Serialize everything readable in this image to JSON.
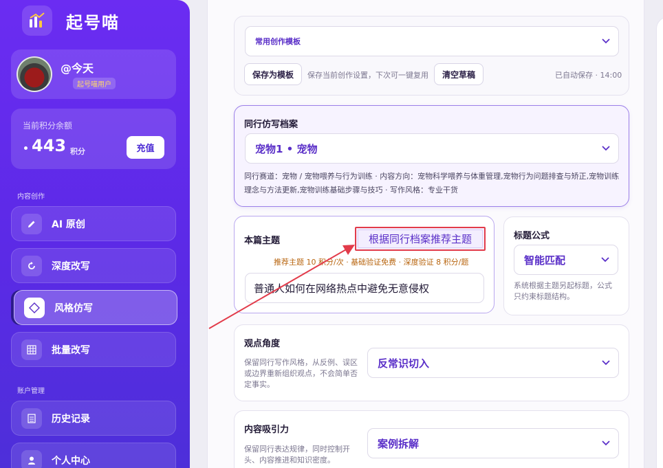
{
  "brand": {
    "name": "起号喵",
    "logo_icon": "chart-bars-icon"
  },
  "profile": {
    "name": "@今天",
    "badge": "起号喵用户"
  },
  "points": {
    "label": "当前积分余额",
    "value": "443",
    "unit": "积分",
    "recharge": "充值"
  },
  "sidebar": {
    "section_create": "内容创作",
    "section_account": "账户管理",
    "items": [
      {
        "label": "AI 原创",
        "icon": "pencil-icon"
      },
      {
        "label": "深度改写",
        "icon": "refresh-icon"
      },
      {
        "label": "风格仿写",
        "icon": "diamond-icon",
        "active": true
      },
      {
        "label": "批量改写",
        "icon": "grid-icon"
      },
      {
        "label": "历史记录",
        "icon": "list-icon"
      },
      {
        "label": "个人中心",
        "icon": "user-icon"
      }
    ]
  },
  "template": {
    "select_value": "常用创作模板",
    "save_button": "保存为模板",
    "save_hint": "保存当前创作设置，下次可一键复用",
    "clear_button": "清空草稿",
    "autosave": "已自动保存 · 14:00"
  },
  "peer_profile": {
    "title": "同行仿写档案",
    "select_value": "宠物1 • 宠物",
    "description": "同行赛道：宠物 / 宠物喂养与行为训练 · 内容方向：宠物科学喂养与体重管理,宠物行为问题排查与矫正,宠物训练理念与方法更新,宠物训练基础步骤与技巧 · 写作风格：专业干货"
  },
  "topic": {
    "title": "本篇主题",
    "recommend_button": "根据同行档案推荐主题",
    "pricing": "推荐主题 10 积分/次 · 基础验证免费 · 深度验证 8 积分/题",
    "input_value": "普通人如何在网络热点中避免无意侵权"
  },
  "title_formula": {
    "title": "标题公式",
    "select_value": "智能匹配",
    "description": "系统根据主题另起标题，公式只约束标题结构。"
  },
  "viewpoint": {
    "title": "观点角度",
    "description": "保留同行写作风格，从反例、误区或边界重新组织观点，不会简单否定事实。",
    "select_value": "反常识切入"
  },
  "appeal": {
    "title": "内容吸引力",
    "description": "保留同行表达规律，同时控制开头、内容推进和知识密度。",
    "select_value": "案例拆解"
  },
  "colors": {
    "primary": "#5a2fc8",
    "sidebar": "#6b2cf2",
    "annotation": "#e23b4a",
    "pricing": "#b8650f"
  }
}
